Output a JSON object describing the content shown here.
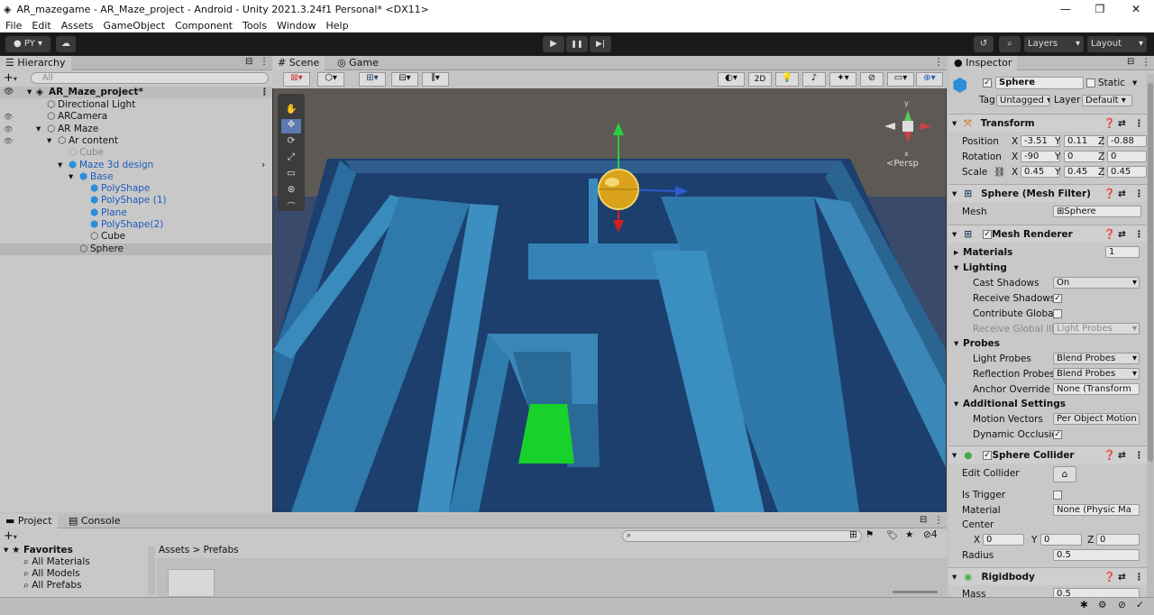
{
  "window": {
    "title": "AR_mazegame - AR_Maze_project - Android - Unity 2021.3.24f1 Personal* <DX11>",
    "min": "—",
    "max": "❐",
    "close": "✕"
  },
  "menu": [
    "File",
    "Edit",
    "Assets",
    "GameObject",
    "Component",
    "Tools",
    "Window",
    "Help"
  ],
  "toolbar": {
    "account": "PY",
    "layers": "Layers",
    "layout": "Layout",
    "play": "▶",
    "pause": "❚❚",
    "step": "▶|"
  },
  "hierarchy": {
    "tab": "Hierarchy",
    "search_placeholder": "All",
    "root": "AR_Maze_project*",
    "items": [
      {
        "label": "Directional Light",
        "style": "normal"
      },
      {
        "label": "ARCamera",
        "style": "normal"
      },
      {
        "label": "AR Maze",
        "style": "normal"
      },
      {
        "label": "Ar content",
        "style": "normal"
      },
      {
        "label": "Cube",
        "style": "grey"
      },
      {
        "label": "Maze 3d design",
        "style": "blue"
      },
      {
        "label": "Base",
        "style": "blue"
      },
      {
        "label": "PolyShape",
        "style": "blue"
      },
      {
        "label": "PolyShape (1)",
        "style": "blue"
      },
      {
        "label": "Plane",
        "style": "blue"
      },
      {
        "label": "PolyShape(2)",
        "style": "blue"
      },
      {
        "label": "Cube",
        "style": "normal"
      },
      {
        "label": "Sphere",
        "style": "normal"
      }
    ]
  },
  "scene": {
    "tab_scene": "Scene",
    "tab_game": "Game",
    "btn_2d": "2D",
    "persp": "<Persp",
    "axis_y": "y",
    "axis_x": "x"
  },
  "project": {
    "tab_project": "Project",
    "tab_console": "Console",
    "favorites": "Favorites",
    "fav_items": [
      "All Materials",
      "All Models",
      "All Prefabs"
    ],
    "breadcrumb_assets": "Assets",
    "breadcrumb_sep": ">",
    "breadcrumb_prefabs": "Prefabs",
    "hidden_count": "4"
  },
  "inspector": {
    "tab": "Inspector",
    "name": "Sphere",
    "static": "Static",
    "tag_label": "Tag",
    "tag": "Untagged",
    "layer_label": "Layer",
    "layer": "Default",
    "transform": {
      "title": "Transform",
      "position": "Position",
      "rotation": "Rotation",
      "scale": "Scale",
      "x": "X",
      "y": "Y",
      "z": "Z",
      "pos": [
        "-3.51",
        "0.11",
        "-0.88"
      ],
      "rot": [
        "-90",
        "0",
        "0"
      ],
      "scl": [
        "0.45",
        "0.45",
        "0.45"
      ]
    },
    "meshfilter": {
      "title": "Sphere (Mesh Filter)",
      "mesh_label": "Mesh",
      "mesh": "Sphere"
    },
    "renderer": {
      "title": "Mesh Renderer",
      "materials": "Materials",
      "materials_count": "1",
      "lighting": "Lighting",
      "cast": "Cast Shadows",
      "cast_val": "On",
      "receive": "Receive Shadows",
      "contribute": "Contribute Global",
      "receive_gi": "Receive Global Illu",
      "receive_gi_val": "Light Probes",
      "probes": "Probes",
      "light_probes": "Light Probes",
      "light_probes_val": "Blend Probes",
      "refl_probes": "Reflection Probes",
      "refl_probes_val": "Blend Probes",
      "anchor": "Anchor Override",
      "anchor_val": "None (Transform",
      "additional": "Additional Settings",
      "motion": "Motion Vectors",
      "motion_val": "Per Object Motion",
      "dynamic": "Dynamic Occlusic"
    },
    "collider": {
      "title": "Sphere Collider",
      "edit": "Edit Collider",
      "trigger": "Is Trigger",
      "material": "Material",
      "material_val": "None (Physic Ma",
      "center": "Center",
      "cx": "0",
      "cy": "0",
      "cz": "0",
      "radius": "Radius",
      "radius_val": "0.5"
    },
    "rigidbody": {
      "title": "Rigidbody",
      "mass": "Mass",
      "mass_val": "0.5"
    }
  }
}
